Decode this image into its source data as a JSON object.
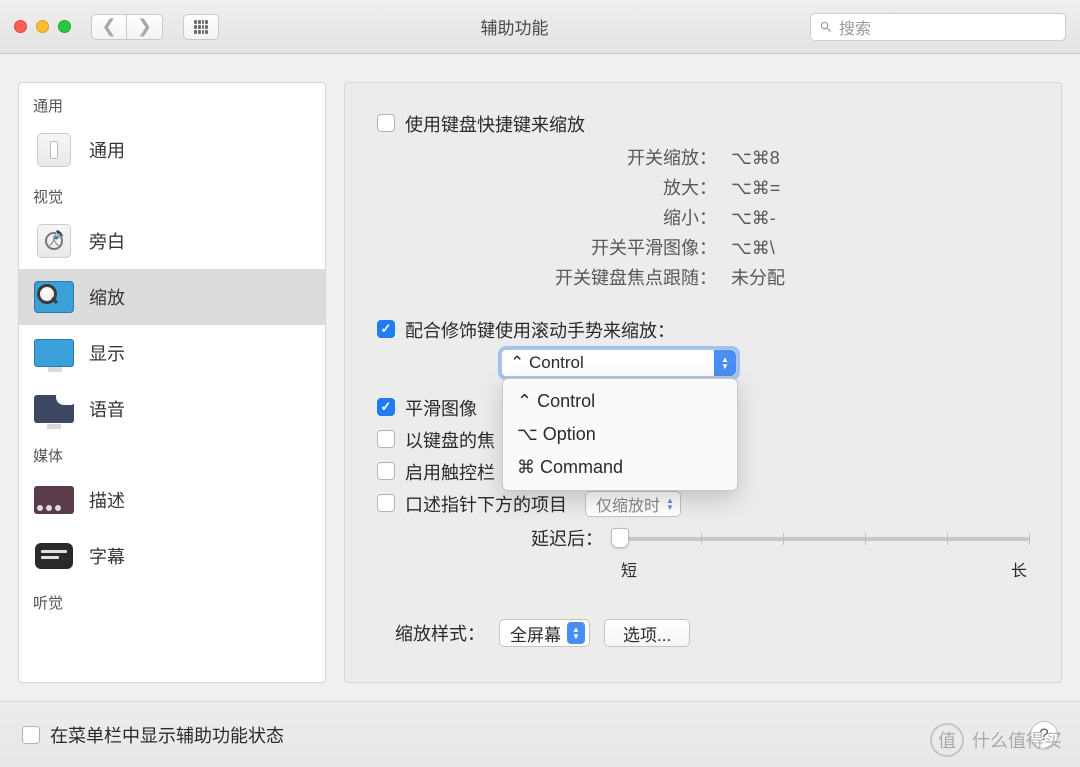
{
  "window": {
    "title": "辅助功能"
  },
  "search": {
    "placeholder": "搜索"
  },
  "sidebar": {
    "sections": [
      {
        "header": "通用",
        "items": [
          {
            "label": "通用",
            "icon": "general"
          }
        ]
      },
      {
        "header": "视觉",
        "items": [
          {
            "label": "旁白",
            "icon": "voiceover"
          },
          {
            "label": "缩放",
            "icon": "zoom",
            "selected": true
          },
          {
            "label": "显示",
            "icon": "display"
          },
          {
            "label": "语音",
            "icon": "speech"
          }
        ]
      },
      {
        "header": "媒体",
        "items": [
          {
            "label": "描述",
            "icon": "description"
          },
          {
            "label": "字幕",
            "icon": "captions"
          }
        ]
      },
      {
        "header": "听觉",
        "items": []
      }
    ]
  },
  "main": {
    "kb_shortcuts": {
      "label": "使用键盘快捷键来缩放",
      "rows": [
        {
          "k": "开关缩放：",
          "v": "⌥⌘8"
        },
        {
          "k": "放大：",
          "v": "⌥⌘="
        },
        {
          "k": "缩小：",
          "v": "⌥⌘-"
        },
        {
          "k": "开关平滑图像：",
          "v": "⌥⌘\\"
        },
        {
          "k": "开关键盘焦点跟随：",
          "v": "未分配"
        }
      ]
    },
    "scroll_gesture": {
      "label": "配合修饰键使用滚动手势来缩放：",
      "selected": "⌃ Control",
      "options": [
        "⌃ Control",
        "⌥ Option",
        "⌘ Command"
      ]
    },
    "smooth": {
      "label": "平滑图像"
    },
    "kb_focus": {
      "label": "以键盘的焦"
    },
    "touchbar": {
      "label": "启用触控栏"
    },
    "speak": {
      "label": "口述指针下方的项目",
      "select": "仅缩放时"
    },
    "delay": {
      "label": "延迟后：",
      "short": "短",
      "long": "长"
    },
    "zoom_style": {
      "label": "缩放样式：",
      "value": "全屏幕"
    },
    "options_btn": "选项..."
  },
  "footer": {
    "label": "在菜单栏中显示辅助功能状态",
    "help": "?"
  },
  "watermark": {
    "brand": "值",
    "text": "什么值得买"
  }
}
